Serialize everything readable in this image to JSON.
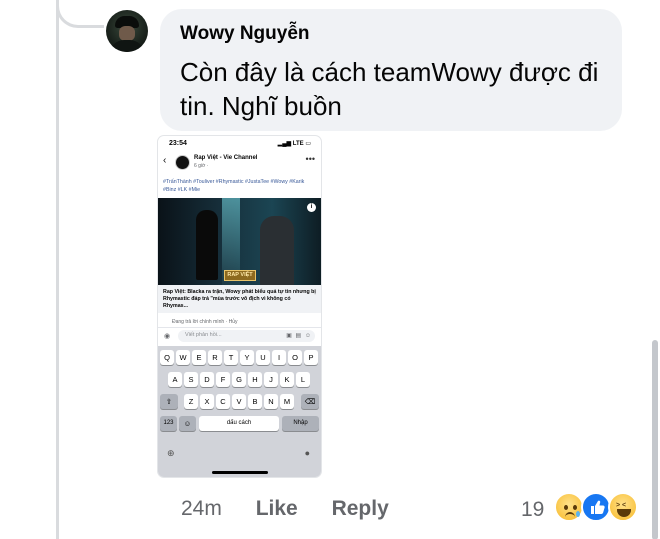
{
  "comment": {
    "author": "Wowy Nguyễn",
    "text": "Còn đây là cách teamWowy được đi tin. Nghĩ buồn"
  },
  "embedded_screenshot": {
    "status_time": "23:54",
    "status_signal": "LTE",
    "page_name": "Rap Việt - Vie Channel",
    "post_time": "6 giờ ·",
    "hashtags": "#TrấnThành #Touliver #Rhymastic #JustaTee #Wowy #Karik #Binz #LK #Mie",
    "video_logo": "RAP VIỆT",
    "caption": "Rap Việt: Blacka ra trận, Wowy phát biểu quá tự tin nhưng bị Rhymastic đáp trả \"mùa trước vô địch vì không có Rhymas...",
    "reply_note": "Đang trả lời chính mình · Hủy",
    "reply_placeholder": "Viết phản hồi...",
    "keyboard": {
      "row1": [
        "Q",
        "W",
        "E",
        "R",
        "T",
        "Y",
        "U",
        "I",
        "O",
        "P"
      ],
      "row2": [
        "A",
        "S",
        "D",
        "F",
        "G",
        "H",
        "J",
        "K",
        "L"
      ],
      "row3": [
        "Z",
        "X",
        "C",
        "V",
        "B",
        "N",
        "M"
      ],
      "num_key": "123",
      "space_key": "dấu cách",
      "return_key": "Nhập"
    }
  },
  "actions": {
    "time": "24m",
    "like": "Like",
    "reply": "Reply",
    "reaction_count": "19",
    "reactions": [
      "sad",
      "like",
      "haha"
    ]
  },
  "colors": {
    "bubble_bg": "#f0f2f5",
    "secondary_text": "#65676b",
    "like_blue": "#1877f2",
    "reaction_yellow": "#f7b928"
  }
}
